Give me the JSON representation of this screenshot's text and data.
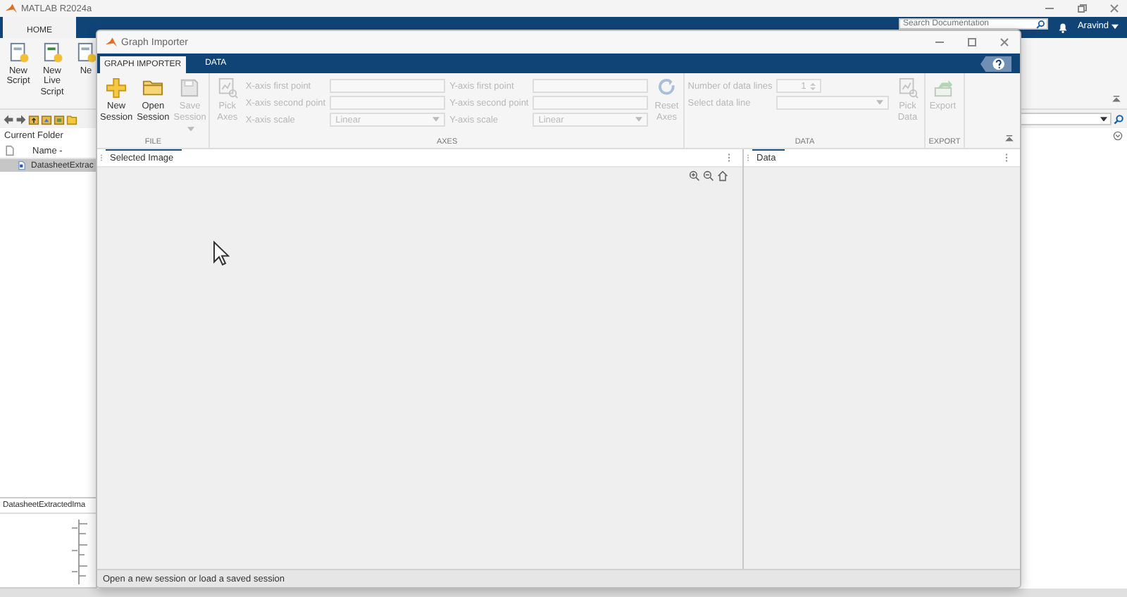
{
  "matlab": {
    "title": "MATLAB R2024a",
    "tabs": [
      {
        "label": "HOME",
        "selected": true
      }
    ],
    "search": {
      "placeholder": "Search Documentation"
    },
    "user": "Aravind",
    "ribbon": [
      {
        "label": "New Script"
      },
      {
        "label": "New Live Script"
      },
      {
        "label": "Ne"
      }
    ],
    "current_folder": {
      "title": "Current Folder",
      "column": "Name -",
      "files": [
        {
          "name": "DatasheetExtrac",
          "selected": true
        }
      ]
    },
    "preview": {
      "title": "DatasheetExtractedIma"
    }
  },
  "graph_importer": {
    "title": "Graph Importer",
    "tabs": [
      {
        "label": "GRAPH IMPORTER",
        "selected": true
      },
      {
        "label": "DATA",
        "selected": false
      }
    ],
    "groups": [
      {
        "label": "FILE",
        "items": [
          {
            "kind": "button",
            "label": "New Session",
            "disabled": false
          },
          {
            "kind": "button",
            "label": "Open Session",
            "disabled": false
          },
          {
            "kind": "menu_button",
            "label": "Save Session",
            "disabled": true
          }
        ]
      },
      {
        "label": "AXES",
        "items": [
          {
            "kind": "button",
            "label": "Pick Axes",
            "disabled": true
          },
          {
            "kind": "fields",
            "rows": [
              {
                "kind": "text",
                "label": "X-axis first point",
                "disabled": true
              },
              {
                "kind": "text",
                "label": "X-axis second point",
                "disabled": true
              },
              {
                "kind": "dropdown",
                "label": "X-axis scale",
                "value": "Linear",
                "disabled": true
              }
            ]
          },
          {
            "kind": "fields",
            "rows": [
              {
                "kind": "text",
                "label": "Y-axis first point",
                "disabled": true
              },
              {
                "kind": "text",
                "label": "Y-axis second point",
                "disabled": true
              },
              {
                "kind": "dropdown",
                "label": "Y-axis scale",
                "value": "Linear",
                "disabled": true
              }
            ]
          },
          {
            "kind": "button",
            "label": "Reset Axes",
            "disabled": true
          }
        ]
      },
      {
        "label": "DATA",
        "items": [
          {
            "kind": "fields",
            "rows": [
              {
                "kind": "spinner",
                "label": "Number of data lines",
                "value": "1",
                "disabled": true
              },
              {
                "kind": "dropdown",
                "label": "Select data line",
                "disabled": true
              }
            ]
          },
          {
            "kind": "button",
            "label": "Pick Data",
            "disabled": true
          }
        ]
      },
      {
        "label": "EXPORT",
        "items": [
          {
            "kind": "button",
            "label": "Export",
            "disabled": true
          }
        ]
      }
    ],
    "panels": [
      {
        "title": "Selected Image"
      },
      {
        "title": "Data"
      }
    ],
    "status": "Open a new session or load a saved session"
  }
}
